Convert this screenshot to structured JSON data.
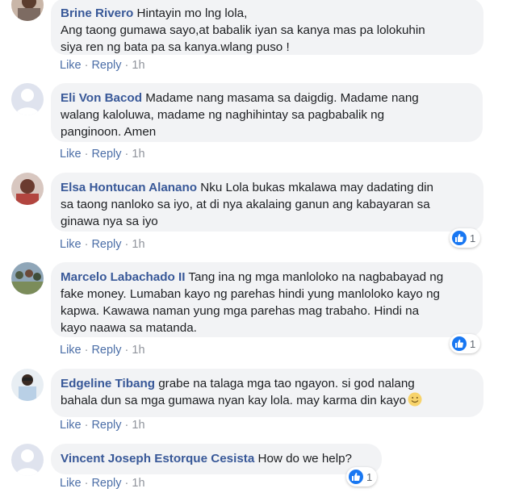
{
  "comments": [
    {
      "author": "Brine Rivero",
      "text_l1": " Hintayin mo lng lola,",
      "text_l2": "Ang taong gumawa sayo,at babalik iyan sa kanya mas pa lolokuhin",
      "text_l3": "siya ren ng bata pa sa kanya.wlang puso !",
      "like": "Like",
      "reply": "Reply",
      "time": "1h",
      "reactions": ""
    },
    {
      "author": "Eli Von Bacod",
      "text_l1": " Madame nang masama sa daigdig. Madame nang",
      "text_l2": "walang kaloluwa, madame ng naghihintay sa pagbabalik ng",
      "text_l3": "panginoon. Amen",
      "like": "Like",
      "reply": "Reply",
      "time": "1h",
      "reactions": ""
    },
    {
      "author": "Elsa Hontucan Alanano",
      "text_l1": " Nku Lola bukas mkalawa may dadating din",
      "text_l2": "sa taong nanloko sa iyo, at di nya akalaing ganun ang kabayaran sa",
      "text_l3": "ginawa nya sa iyo",
      "like": "Like",
      "reply": "Reply",
      "time": "1h",
      "reactions": "1"
    },
    {
      "author": "Marcelo Labachado II",
      "text_l1": " Tang ina ng mga manloloko na nagbabayad ng",
      "text_l2": "fake money. Lumaban kayo ng parehas hindi yung manloloko kayo ng",
      "text_l3": "kapwa. Kawawa naman yung mga parehas mag trabaho. Hindi na",
      "text_l4": "kayo naawa sa matanda.",
      "like": "Like",
      "reply": "Reply",
      "time": "1h",
      "reactions": "1"
    },
    {
      "author": "Edgeline Tibang",
      "text_l1": " grabe na talaga mga tao ngayon. si god nalang",
      "text_l2": "bahala dun sa mga gumawa nyan kay lola. may karma din kayo",
      "like": "Like",
      "reply": "Reply",
      "time": "1h",
      "reactions": ""
    },
    {
      "author": "Vincent Joseph Estorque Cesista",
      "text_l1": " How do we help?",
      "like": "Like",
      "reply": "Reply",
      "time": "1h",
      "reactions": "1"
    }
  ],
  "separator": "·",
  "colors": {
    "name": "#385898",
    "bubble": "#f2f3f5",
    "link": "#4b6ea7",
    "like_blue": "#1877f2"
  },
  "icons": {
    "default_avatar": "default-avatar-icon",
    "like": "like-thumb-icon",
    "smile": "smile-emoji-icon"
  }
}
